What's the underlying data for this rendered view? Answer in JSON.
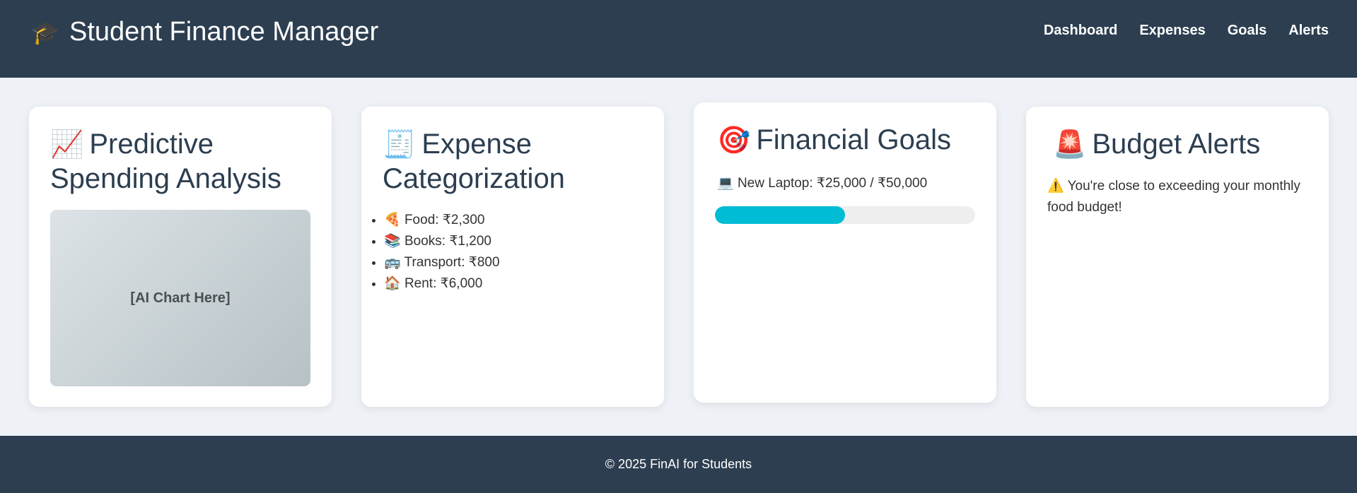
{
  "header": {
    "icon": "🎓",
    "title": "Student Finance Manager",
    "nav": [
      "Dashboard",
      "Expenses",
      "Goals",
      "Alerts"
    ]
  },
  "cards": {
    "prediction": {
      "icon": "📈",
      "title": "Predictive Spending Analysis",
      "chart_placeholder": "[AI Chart Here]"
    },
    "categorization": {
      "icon": "🧾",
      "title": "Expense Categorization",
      "items": [
        {
          "icon": "🍕",
          "text": "Food: ₹2,300"
        },
        {
          "icon": "📚",
          "text": "Books: ₹1,200"
        },
        {
          "icon": "🚌",
          "text": "Transport: ₹800"
        },
        {
          "icon": "🏠",
          "text": "Rent: ₹6,000"
        }
      ]
    },
    "goals": {
      "icon": "🎯",
      "title": "Financial Goals",
      "goal_icon": "💻",
      "goal_text": "New Laptop: ₹25,000 / ₹50,000",
      "progress": 0.5
    },
    "alerts": {
      "icon": "🚨",
      "title": "Budget Alerts",
      "message": "⚠️ You're close to exceeding your monthly food budget!"
    }
  },
  "footer": {
    "text": "© 2025 FinAI for Students"
  },
  "colors": {
    "header_bg": "#2c3e50",
    "page_bg": "#eef2f7",
    "progress_fill": "#00bcd4",
    "progress_track": "#eeeeee"
  }
}
